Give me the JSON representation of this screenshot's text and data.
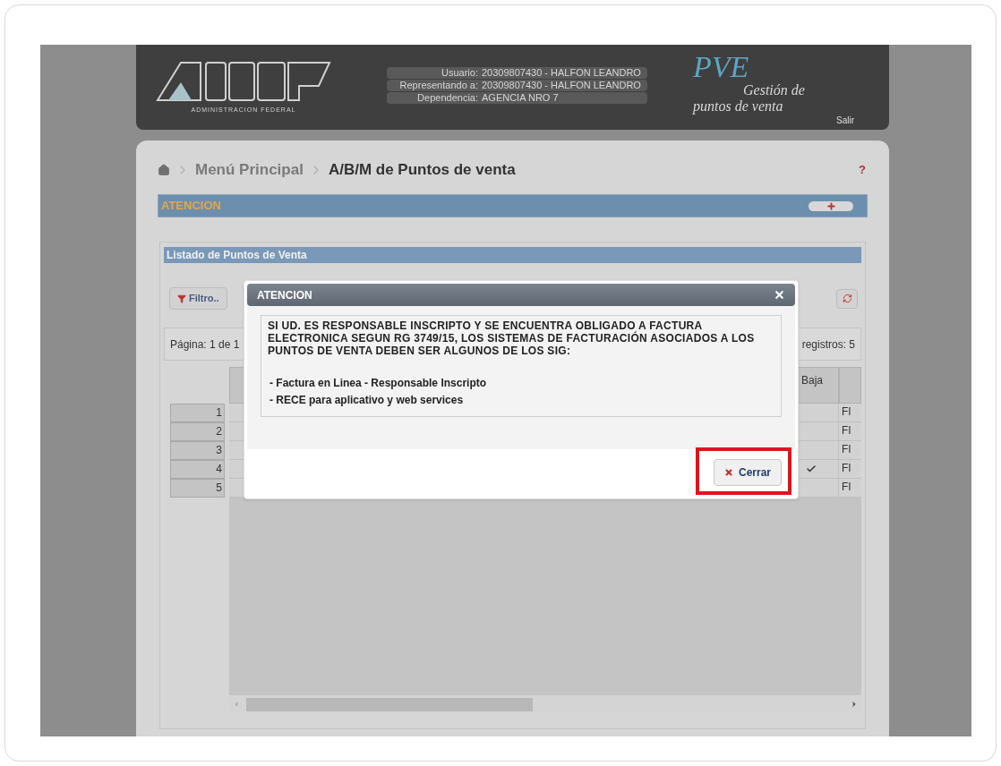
{
  "header": {
    "logo_caption": "ADMINISTRACION FEDERAL",
    "user_info": [
      {
        "label": "Usuario:",
        "value": "20309807430 - HALFON LEANDRO"
      },
      {
        "label": "Representando a:",
        "value": "20309807430 - HALFON LEANDRO"
      },
      {
        "label": "Dependencia:",
        "value": "AGENCIA NRO 7"
      }
    ],
    "app_name": "PVE",
    "app_subtitle": [
      "Gestión de",
      "puntos de venta"
    ],
    "logout": "Salir"
  },
  "breadcrumb": [
    {
      "label": "Menú Principal",
      "current": false
    },
    {
      "label": "A/B/M de Puntos de venta",
      "current": true
    }
  ],
  "help": "?",
  "notice_bar": {
    "title": "ATENCION",
    "expanded": false
  },
  "listing": {
    "title": "Listado de Puntos de Venta",
    "filter_button": "Filtro..",
    "pager_left": "Página: 1 de 1",
    "pager_right": "registros: 5",
    "baja_heading": "Baja",
    "rows": [
      {
        "number": "1",
        "baja": false,
        "column_5": "FI"
      },
      {
        "number": "2",
        "baja": false,
        "column_5": "FI"
      },
      {
        "number": "3",
        "baja": false,
        "column_5": "FI"
      },
      {
        "number": "4",
        "baja": true,
        "column_5": "FI"
      },
      {
        "number": "5",
        "baja": false,
        "column_5": "FI"
      }
    ]
  },
  "dialog": {
    "title": "ATENCION",
    "message": "SI UD. ES RESPONSABLE INSCRIPTO Y SE ENCUENTRA OBLIGADO A FACTURA ELECTRONICA SEGUN RG 3749/15, LOS SISTEMAS DE FACTURACIÓN ASOCIADOS A LOS PUNTOS DE VENTA DEBEN SER ALGUNOS DE LOS SIG:",
    "items": [
      "- Factura en Linea - Responsable Inscripto",
      "- RECE para aplicativo y web services"
    ],
    "button": "Cerrar",
    "highlighted": true
  }
}
